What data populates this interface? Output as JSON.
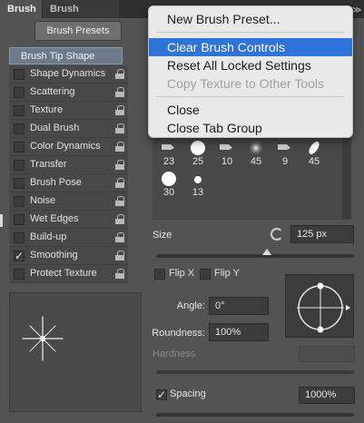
{
  "tabs": [
    {
      "label": "Brush",
      "active": true
    },
    {
      "label": "Brush Presets",
      "active": false
    }
  ],
  "presets_button": "Brush Presets",
  "sidebar": {
    "selected_item": "Brush Tip Shape",
    "items": [
      {
        "label": "Shape Dynamics",
        "checked": false
      },
      {
        "label": "Scattering",
        "checked": false
      },
      {
        "label": "Texture",
        "checked": false
      },
      {
        "label": "Dual Brush",
        "checked": false
      },
      {
        "label": "Color Dynamics",
        "checked": false
      },
      {
        "label": "Transfer",
        "checked": false
      },
      {
        "label": "Brush Pose",
        "checked": false
      },
      {
        "label": "Noise",
        "checked": false
      },
      {
        "label": "Wet Edges",
        "checked": false
      },
      {
        "label": "Build-up",
        "checked": false
      },
      {
        "label": "Smoothing",
        "checked": true
      },
      {
        "label": "Protect Texture",
        "checked": false
      }
    ]
  },
  "brush_tiles": [
    {
      "size": "23",
      "icon": "tapered-brush-icon"
    },
    {
      "size": "25",
      "icon": "hard-round-brush-icon"
    },
    {
      "size": "10",
      "icon": "tapered-brush-icon"
    },
    {
      "size": "45",
      "icon": "soft-round-brush-icon"
    },
    {
      "size": "9",
      "icon": "tapered-brush-icon"
    },
    {
      "size": "45",
      "icon": "leaf-brush-icon"
    },
    {
      "size": "30",
      "icon": "hard-round-brush-icon"
    },
    {
      "size": "13",
      "icon": "small-round-brush-icon"
    }
  ],
  "size": {
    "label": "Size",
    "value": "125 px",
    "slider_fraction": 0.56
  },
  "flip": {
    "x_label": "Flip X",
    "y_label": "Flip Y"
  },
  "angle": {
    "label": "Angle:",
    "value": "0°"
  },
  "roundness": {
    "label": "Roundness:",
    "value": "100%"
  },
  "hardness": {
    "label": "Hardness"
  },
  "spacing": {
    "label": "Spacing",
    "value": "1000%",
    "checked": true
  },
  "context_menu": {
    "items": [
      {
        "label": "New Brush Preset...",
        "state": "normal"
      },
      {
        "label": "Clear Brush Controls",
        "state": "highlighted"
      },
      {
        "label": "Reset All Locked Settings",
        "state": "normal"
      },
      {
        "label": "Copy Texture to Other Tools",
        "state": "disabled"
      },
      {
        "label": "Close",
        "state": "normal"
      },
      {
        "label": "Close Tab Group",
        "state": "normal"
      }
    ]
  },
  "colors": {
    "panel_bg": "#535353",
    "selected_item_bg": "#6c7b8c",
    "menu_highlight": "#2f72d8"
  }
}
